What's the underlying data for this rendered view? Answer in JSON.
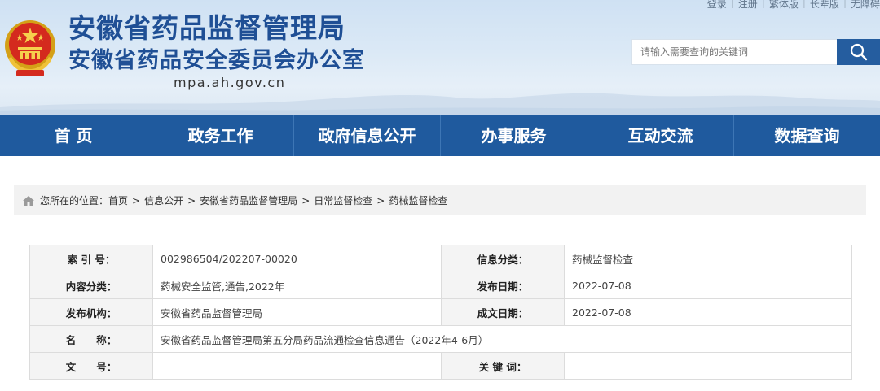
{
  "header": {
    "top_links": [
      "登录",
      "注册",
      "繁体版",
      "长辈版",
      "无障碍"
    ],
    "title": "安徽省药品监督管理局",
    "subtitle": "安徽省药品安全委员会办公室",
    "domain": "mpa.ah.gov.cn",
    "search": {
      "placeholder": "请输入需要查询的关键词",
      "icon": "search-icon"
    },
    "emblem": "national-emblem"
  },
  "nav": {
    "items": [
      "首 页",
      "政务工作",
      "政府信息公开",
      "办事服务",
      "互动交流",
      "数据查询"
    ]
  },
  "breadcrumb": {
    "prefix": "您所在的位置：",
    "items": [
      "首页",
      "信息公开",
      "安徽省药品监督管理局",
      "日常监督检查",
      "药械监督检查"
    ],
    "separator": ">",
    "icon": "home-icon"
  },
  "info": {
    "index_label": "索 引 号：",
    "index_value": "002986504/202207-00020",
    "category_label": "信息分类：",
    "category_value": "药械监督检查",
    "content_type_label": "内容分类：",
    "content_type_value": "药械安全监管,通告,2022年",
    "publish_date_label": "发布日期：",
    "publish_date_value": "2022-07-08",
    "publisher_label": "发布机构：",
    "publisher_value": "安徽省药品监督管理局",
    "created_date_label": "成文日期：",
    "created_date_value": "2022-07-08",
    "name_label": "名　　称：",
    "name_value": "安徽省药品监督管理局第五分局药品流通检查信息通告（2022年4-6月）",
    "doc_no_label": "文　　号：",
    "doc_no_value": "",
    "keywords_label": "关 键 词：",
    "keywords_value": ""
  },
  "colors": {
    "brand_blue": "#1f5a9e",
    "title_blue": "#1f4f95",
    "search_button": "#255d9f"
  }
}
